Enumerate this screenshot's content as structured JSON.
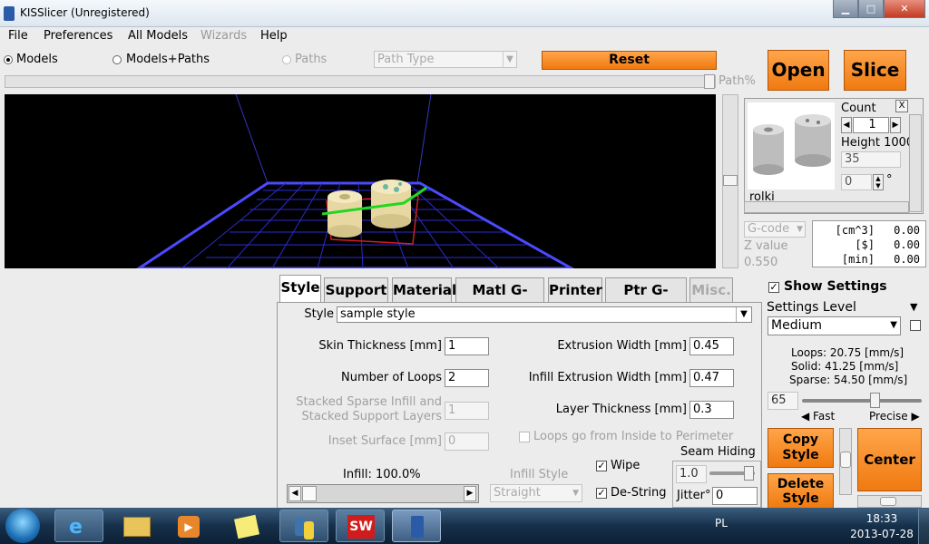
{
  "window": {
    "title": "KISSlicer (Unregistered)",
    "minimize": "▁",
    "maximize": "□",
    "close": "✕"
  },
  "menu": [
    "File",
    "Preferences",
    "All Models",
    "Wizards",
    "Help"
  ],
  "view_mode": {
    "models": "Models",
    "models_paths": "Models+Paths",
    "paths": "Paths",
    "selected": "Models"
  },
  "path_type": {
    "value": "Path Type"
  },
  "buttons": {
    "reset": "Reset",
    "open": "Open",
    "slice": "Slice",
    "copy_style_1": "Copy",
    "copy_style_2": "Style",
    "delete_style_1": "Delete",
    "delete_style_2": "Style",
    "center": "Center"
  },
  "path_slider": {
    "label": "Path%"
  },
  "model": {
    "close": "X",
    "count_label": "Count",
    "count": "1",
    "height_label": "Height 1000",
    "height": "35",
    "rotation": "0",
    "deg": "°",
    "name": "rolki"
  },
  "gcode_panel": {
    "select": "G-code",
    "z_label": "Z value",
    "z_value": "0.550",
    "rows": [
      {
        "unit": "[cm^3]",
        "value": "0.00"
      },
      {
        "unit": "[$]",
        "value": "0.00"
      },
      {
        "unit": "[min]",
        "value": "0.00"
      }
    ]
  },
  "tabs": [
    "Style",
    "Support",
    "Material",
    "Matl G-code",
    "Printer",
    "Ptr G-code",
    "Misc."
  ],
  "style": {
    "style_label": "Style",
    "style_value": "sample style",
    "skin_label": "Skin Thickness [mm]",
    "skin": "1",
    "loops_label": "Number of Loops",
    "loops": "2",
    "stacked_label_1": "Stacked Sparse Infill and",
    "stacked_label_2": "Stacked Support Layers",
    "stacked": "1",
    "inset_label": "Inset  Surface [mm]",
    "inset": "0",
    "ext_width_label": "Extrusion Width [mm]",
    "ext_width": "0.45",
    "infill_ext_label": "Infill Extrusion Width [mm]",
    "infill_ext": "0.47",
    "layer_label": "Layer Thickness [mm]",
    "layer": "0.3",
    "loops_dir_label": "Loops go from Inside to Perimeter",
    "infill_label": "Infill: 100.0%",
    "infill_style_label": "Infill Style",
    "infill_style": "Straight",
    "wipe": "Wipe",
    "destring": "De-String",
    "seam_label": "Seam Hiding",
    "seam": "1.0",
    "jitter_label": "Jitter°",
    "jitter": "0"
  },
  "settings": {
    "show_label": "Show Settings",
    "level_label": "Settings Level",
    "level": "Medium",
    "loops_speed": "Loops:  20.75 [mm/s]",
    "solid_speed": "Solid:  41.25 [mm/s]",
    "sparse_speed": "Sparse:  54.50 [mm/s]",
    "speed_value": "65",
    "fast": "Fast",
    "precise": "Precise"
  },
  "taskbar": {
    "lang": "PL",
    "time": "18:33",
    "date": "2013-07-28"
  },
  "colors": {
    "accent_orange": "#f5841f",
    "grid_blue": "#3b3bd8",
    "toolpath_green": "#22d622"
  }
}
